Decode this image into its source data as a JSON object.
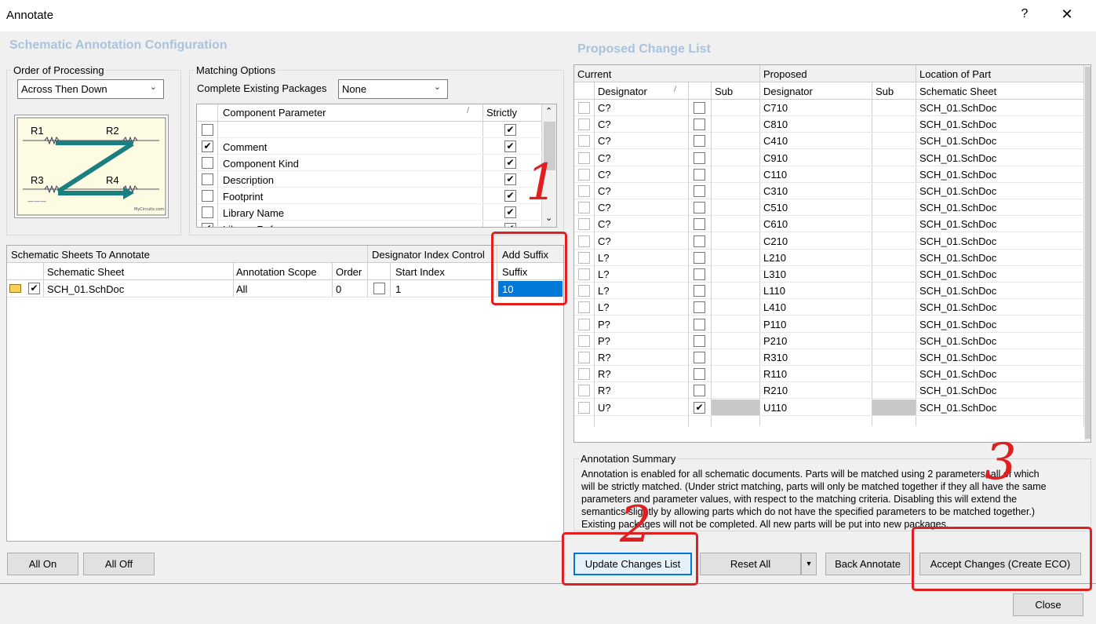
{
  "window": {
    "title": "Annotate",
    "help": "?",
    "close": "✕"
  },
  "config": {
    "section_title": "Schematic Annotation Configuration",
    "order": {
      "legend": "Order of Processing",
      "value": "Across Then Down",
      "diagram": {
        "r1": "R1",
        "r2": "R2",
        "r3": "R3",
        "r4": "R4",
        "credit": "MyCircuits.com"
      }
    },
    "matching": {
      "legend": "Matching Options",
      "cep_label": "Complete Existing Packages",
      "cep_value": "None",
      "headers": {
        "param": "Component Parameter",
        "strictly": "Strictly"
      },
      "rows": [
        {
          "name": "",
          "checked": false,
          "strict": true
        },
        {
          "name": "Comment",
          "checked": true,
          "strict": true
        },
        {
          "name": "Component Kind",
          "checked": false,
          "strict": true
        },
        {
          "name": "Description",
          "checked": false,
          "strict": true
        },
        {
          "name": "Footprint",
          "checked": false,
          "strict": true
        },
        {
          "name": "Library Name",
          "checked": false,
          "strict": true
        },
        {
          "name": "Library Reference",
          "checked": true,
          "strict": true
        }
      ]
    },
    "sheets": {
      "group_headers": {
        "sheets": "Schematic Sheets To Annotate",
        "index": "Designator Index Control",
        "suffix": "Add Suffix"
      },
      "headers": {
        "sheet": "Schematic Sheet",
        "scope": "Annotation Scope",
        "order": "Order",
        "start": "Start Index",
        "suffix": "Suffix"
      },
      "rows": [
        {
          "sheet": "SCH_01.SchDoc",
          "scope": "All",
          "order": "0",
          "start": "1",
          "suffix": "10"
        }
      ]
    },
    "buttons": {
      "all_on": "All On",
      "all_off": "All Off"
    }
  },
  "changes": {
    "section_title": "Proposed Change List",
    "group_headers": {
      "current": "Current",
      "proposed": "Proposed",
      "location": "Location of Part"
    },
    "headers": {
      "designator": "Designator",
      "sub": "Sub",
      "sheet": "Schematic Sheet"
    },
    "rows": [
      {
        "cur": "C?",
        "prop": "C710",
        "sheet": "SCH_01.SchDoc"
      },
      {
        "cur": "C?",
        "prop": "C810",
        "sheet": "SCH_01.SchDoc"
      },
      {
        "cur": "C?",
        "prop": "C410",
        "sheet": "SCH_01.SchDoc"
      },
      {
        "cur": "C?",
        "prop": "C910",
        "sheet": "SCH_01.SchDoc"
      },
      {
        "cur": "C?",
        "prop": "C110",
        "sheet": "SCH_01.SchDoc"
      },
      {
        "cur": "C?",
        "prop": "C310",
        "sheet": "SCH_01.SchDoc"
      },
      {
        "cur": "C?",
        "prop": "C510",
        "sheet": "SCH_01.SchDoc"
      },
      {
        "cur": "C?",
        "prop": "C610",
        "sheet": "SCH_01.SchDoc"
      },
      {
        "cur": "C?",
        "prop": "C210",
        "sheet": "SCH_01.SchDoc"
      },
      {
        "cur": "L?",
        "prop": "L210",
        "sheet": "SCH_01.SchDoc"
      },
      {
        "cur": "L?",
        "prop": "L310",
        "sheet": "SCH_01.SchDoc"
      },
      {
        "cur": "L?",
        "prop": "L110",
        "sheet": "SCH_01.SchDoc"
      },
      {
        "cur": "L?",
        "prop": "L410",
        "sheet": "SCH_01.SchDoc"
      },
      {
        "cur": "P?",
        "prop": "P110",
        "sheet": "SCH_01.SchDoc"
      },
      {
        "cur": "P?",
        "prop": "P210",
        "sheet": "SCH_01.SchDoc"
      },
      {
        "cur": "R?",
        "prop": "R310",
        "sheet": "SCH_01.SchDoc"
      },
      {
        "cur": "R?",
        "prop": "R110",
        "sheet": "SCH_01.SchDoc"
      },
      {
        "cur": "R?",
        "prop": "R210",
        "sheet": "SCH_01.SchDoc"
      },
      {
        "cur": "U?",
        "prop": "U110",
        "sheet": "SCH_01.SchDoc",
        "subchecked": true,
        "grey": true
      }
    ]
  },
  "summary": {
    "legend": "Annotation Summary",
    "lines": [
      "Annotation is enabled for all schematic documents. Parts will be matched using 2 parameters, all of which",
      "will be strictly matched. (Under strict matching, parts will only be matched together if they all have the same",
      "parameters and parameter values, with respect to the matching criteria. Disabling this will extend the",
      "semantics slightly by allowing parts which do not have the specified parameters to be matched together.)",
      "Existing packages will not be completed. All new parts will be put into new packages."
    ]
  },
  "buttons": {
    "update": "Update Changes List",
    "reset": "Reset All",
    "back": "Back Annotate",
    "accept": "Accept Changes (Create ECO)",
    "close": "Close"
  },
  "marks": {
    "one": "1",
    "two": "2",
    "three": "3"
  }
}
